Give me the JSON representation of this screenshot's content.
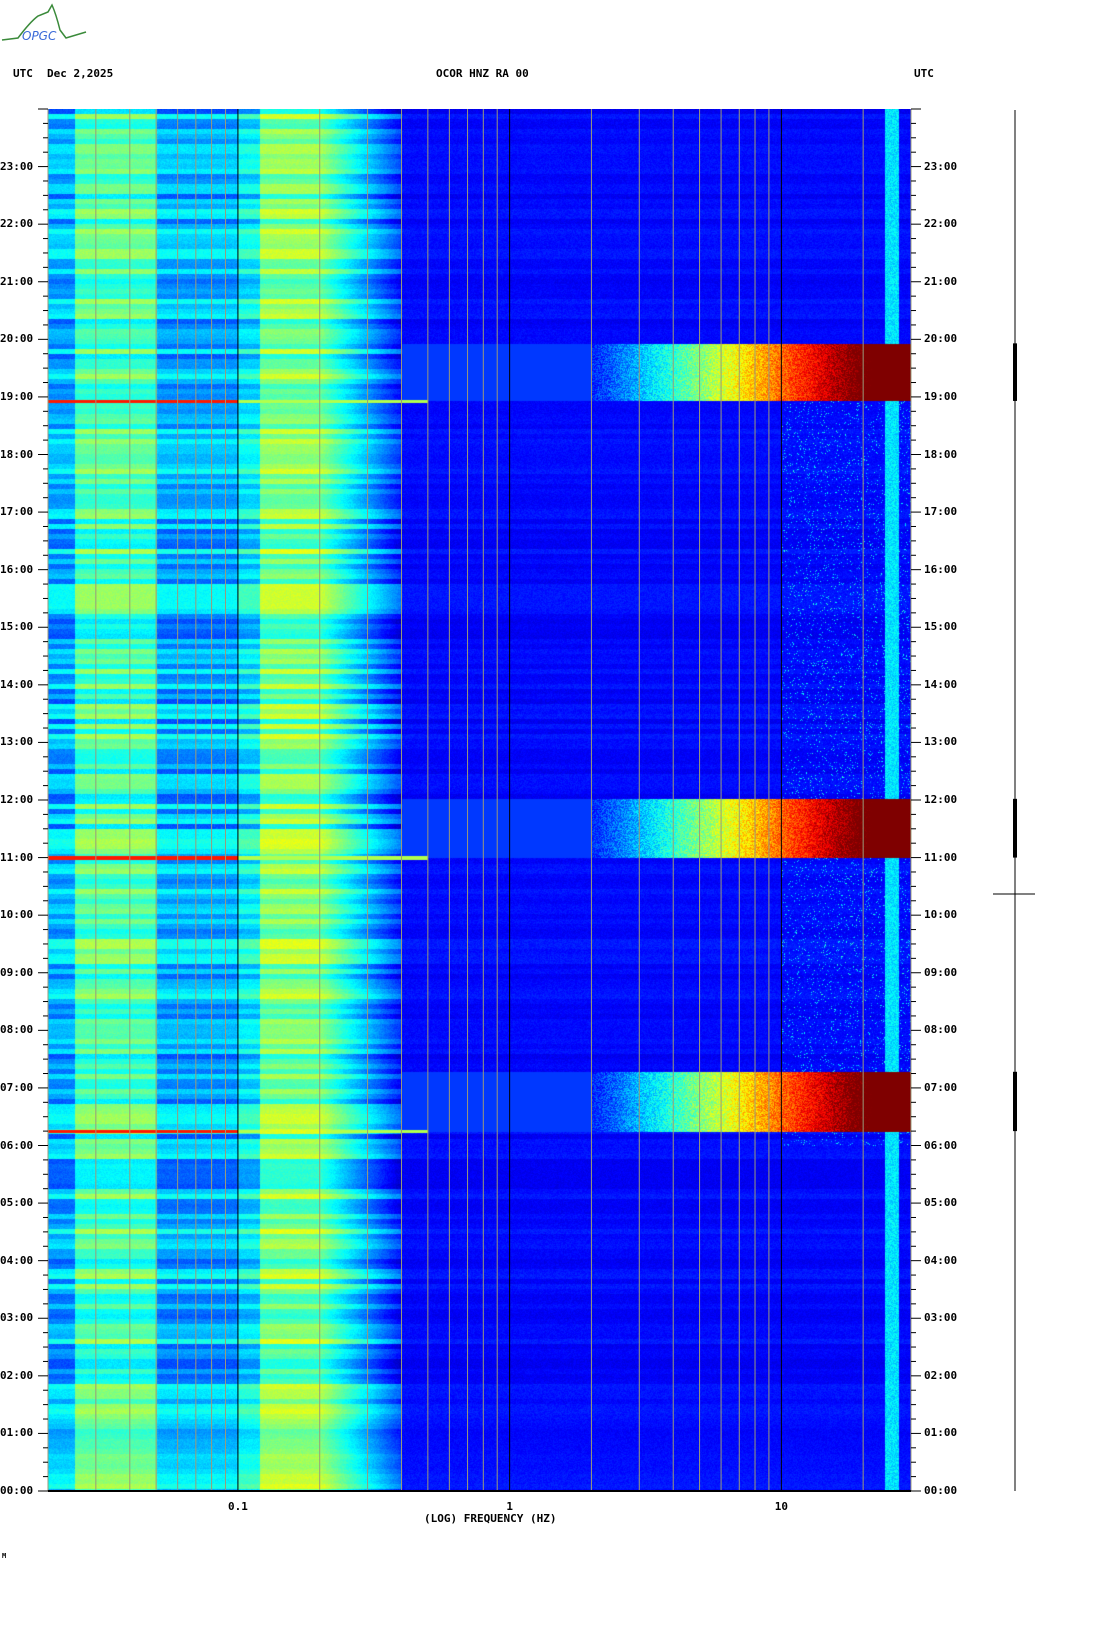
{
  "header": {
    "left_tz": "UTC",
    "date": "Dec 2,2025",
    "station": "OCOR HNZ RA 00",
    "right_tz": "UTC"
  },
  "logo": {
    "text": "OPGC"
  },
  "footer_mark": "M",
  "chart_data": {
    "type": "heatmap",
    "title": "OCOR HNZ RA 00",
    "xlabel": "(LOG) FREQUENCY (HZ)",
    "ylabel": "UTC",
    "xscale": "log",
    "xlim": [
      0.02,
      30
    ],
    "ylim_hours": [
      0,
      24
    ],
    "x_ticks": [
      {
        "value": 0.1,
        "label": "0.1"
      },
      {
        "value": 1,
        "label": "1"
      },
      {
        "value": 10,
        "label": "10"
      }
    ],
    "y_ticks": [
      "00:00",
      "01:00",
      "02:00",
      "03:00",
      "04:00",
      "05:00",
      "06:00",
      "07:00",
      "08:00",
      "09:00",
      "10:00",
      "11:00",
      "12:00",
      "13:00",
      "14:00",
      "15:00",
      "16:00",
      "17:00",
      "18:00",
      "19:00",
      "20:00",
      "21:00",
      "22:00",
      "23:00"
    ],
    "colormap": "jet",
    "high_energy_events_hours": [
      [
        6.25,
        7.28
      ],
      [
        11.0,
        12.02
      ],
      [
        18.93,
        19.93
      ]
    ],
    "persistent_band_hz": [
      24,
      27
    ],
    "microseism_band_hz": [
      0.12,
      0.2
    ]
  }
}
